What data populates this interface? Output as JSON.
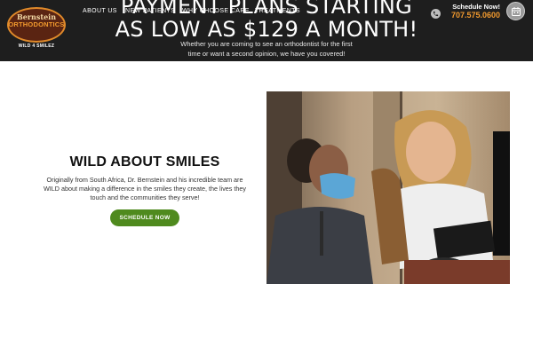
{
  "header": {
    "logo": {
      "top_text": "Bernstein",
      "main_text": "ORTHODONTICS",
      "sub_text": "WILD 4 SMILEZ"
    },
    "nav": [
      {
        "label": "ABOUT US"
      },
      {
        "label": "NEW PATIENTS"
      },
      {
        "label": "WHY CHOOSE CARE"
      },
      {
        "label": "TREATMENTS"
      }
    ],
    "hero": {
      "title_line1": "PAYMENT PLANS STARTING",
      "title_line2": "AS LOW AS $129 A MONTH!",
      "text": "Whether you are coming to see an orthodontist for the first time or want a second opinion, we have you covered!"
    },
    "cta": {
      "schedule_label": "Schedule Now!",
      "phone": "707.575.0600",
      "phone_icon": "phone-icon",
      "calendar_icon": "calendar-icon"
    }
  },
  "main": {
    "title": "WILD ABOUT SMILES",
    "text": "Originally from South Africa, Dr. Bernstein and his incredible team are WILD about making a difference in the smiles they create, the lives they touch and the communities they serve!",
    "button_label": "SCHEDULE NOW",
    "photo_subject": "orthodontic-team-photo"
  },
  "colors": {
    "header_bg": "#1e1e1e",
    "accent_orange": "#f29a2e",
    "button_green": "#4f8a1e"
  }
}
